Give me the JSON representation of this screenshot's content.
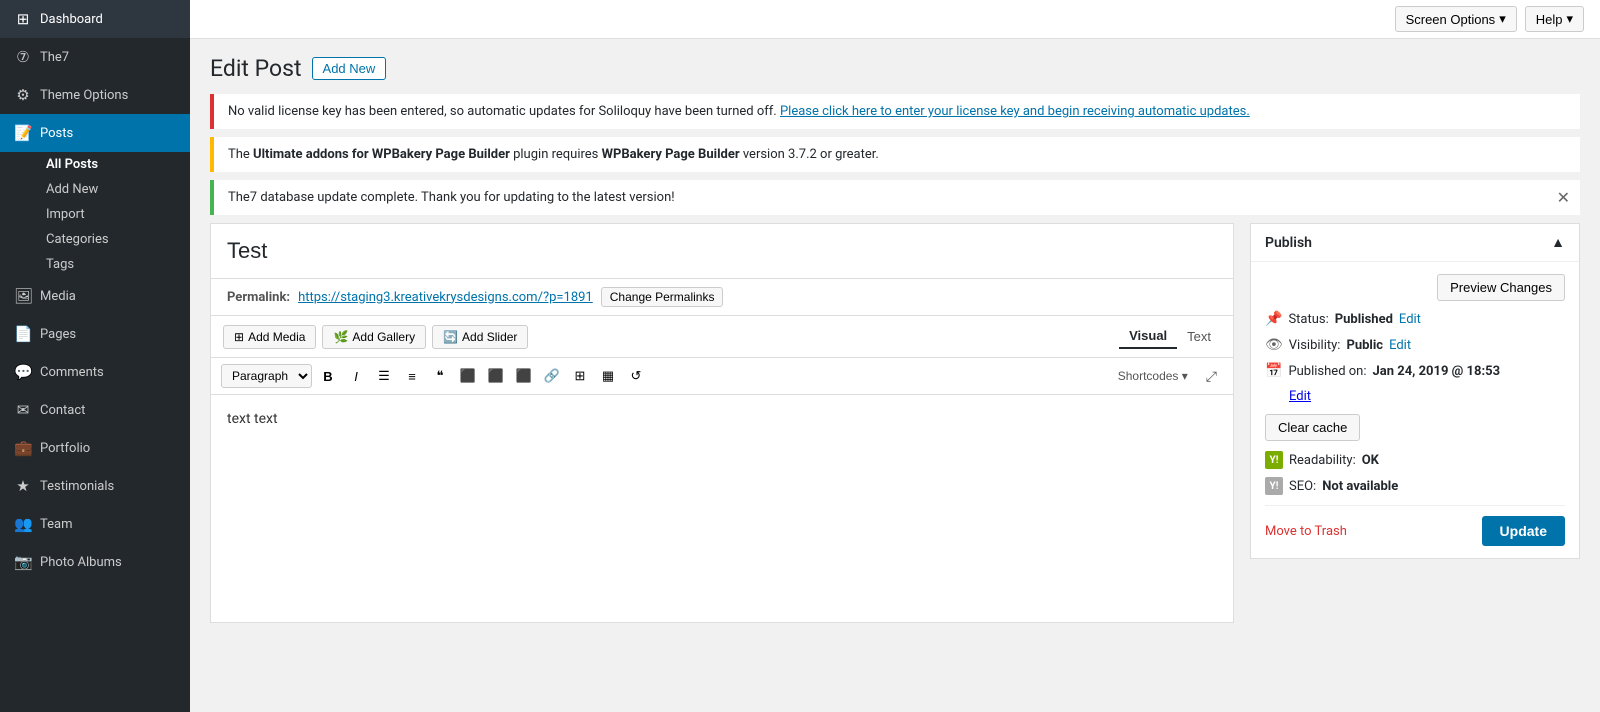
{
  "sidebar": {
    "items": [
      {
        "id": "dashboard",
        "label": "Dashboard",
        "icon": "⊞"
      },
      {
        "id": "the7",
        "label": "The7",
        "icon": "⑦"
      },
      {
        "id": "theme-options",
        "label": "Theme Options",
        "icon": "⚙"
      },
      {
        "id": "posts",
        "label": "Posts",
        "icon": "📝",
        "active": true
      },
      {
        "id": "media",
        "label": "Media",
        "icon": "🖼"
      },
      {
        "id": "pages",
        "label": "Pages",
        "icon": "📄"
      },
      {
        "id": "comments",
        "label": "Comments",
        "icon": "💬"
      },
      {
        "id": "contact",
        "label": "Contact",
        "icon": "✉"
      },
      {
        "id": "portfolio",
        "label": "Portfolio",
        "icon": "💼"
      },
      {
        "id": "testimonials",
        "label": "Testimonials",
        "icon": "★"
      },
      {
        "id": "team",
        "label": "Team",
        "icon": "👥"
      },
      {
        "id": "photo-albums",
        "label": "Photo Albums",
        "icon": "📷"
      }
    ],
    "posts_submenu": [
      {
        "id": "all-posts",
        "label": "All Posts",
        "active": true
      },
      {
        "id": "add-new",
        "label": "Add New"
      },
      {
        "id": "import",
        "label": "Import"
      },
      {
        "id": "categories",
        "label": "Categories"
      },
      {
        "id": "tags",
        "label": "Tags"
      }
    ]
  },
  "topbar": {
    "screen_options": "Screen Options",
    "help": "Help"
  },
  "page": {
    "title": "Edit Post",
    "add_new": "Add New"
  },
  "notices": [
    {
      "id": "license-notice",
      "type": "error",
      "text": "No valid license key has been entered, so automatic updates for Soliloquy have been turned off.",
      "link_text": "Please click here to enter your license key and begin receiving automatic updates.",
      "link_href": "#"
    },
    {
      "id": "plugin-notice",
      "type": "warning",
      "text_parts": [
        "The ",
        "Ultimate addons for WPBakery Page Builder",
        " plugin requires ",
        "WPBakery Page Builder",
        " version 3.7.2 or greater."
      ]
    },
    {
      "id": "db-notice",
      "type": "success",
      "text": "The7 database update complete. Thank you for updating to the latest version!",
      "dismissible": true
    }
  ],
  "editor": {
    "post_title": "Test",
    "permalink_label": "Permalink:",
    "permalink_url": "https://staging3.kreativekrysdesigns.com/?p=1891",
    "change_permalinks": "Change Permalinks",
    "add_media": "Add Media",
    "add_gallery": "Add Gallery",
    "add_slider": "Add Slider",
    "tab_visual": "Visual",
    "tab_text": "Text",
    "format_select_value": "Paragraph",
    "shortcodes_label": "Shortcodes",
    "body_text": "text text"
  },
  "publish_panel": {
    "title": "Publish",
    "preview_changes": "Preview Changes",
    "status_label": "Status:",
    "status_value": "Published",
    "status_edit": "Edit",
    "visibility_label": "Visibility:",
    "visibility_value": "Public",
    "visibility_edit": "Edit",
    "published_on_label": "Published on:",
    "published_on_value": "Jan 24, 2019 @ 18:53",
    "published_on_edit": "Edit",
    "clear_cache": "Clear cache",
    "readability_label": "Readability:",
    "readability_value": "OK",
    "seo_label": "SEO:",
    "seo_value": "Not available",
    "move_trash": "Move to Trash",
    "update": "Update"
  }
}
